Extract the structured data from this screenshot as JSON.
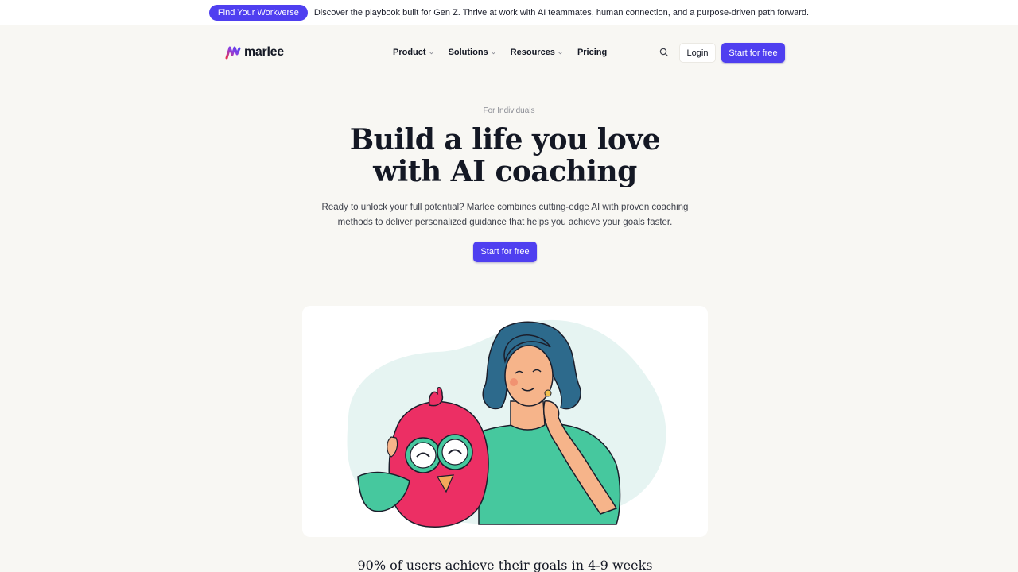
{
  "announcement": {
    "pill_label": "Find Your Workverse",
    "text": "Discover the playbook built for Gen Z. Thrive at work with AI teammates, human connection, and a purpose-driven path forward."
  },
  "brand": {
    "name": "marlee"
  },
  "nav": {
    "items": [
      {
        "label": "Product",
        "dropdown": true
      },
      {
        "label": "Solutions",
        "dropdown": true
      },
      {
        "label": "Resources",
        "dropdown": true
      },
      {
        "label": "Pricing",
        "dropdown": false
      }
    ],
    "login_label": "Login",
    "cta_label": "Start for free"
  },
  "hero": {
    "eyebrow": "For Individuals",
    "title_line1": "Build a life you love",
    "title_line2": "with AI coaching",
    "subtitle": "Ready to unlock your full potential? Marlee combines cutting-edge AI with proven coaching methods to deliver personalized guidance that helps you achieve your goals faster.",
    "cta_label": "Start for free"
  },
  "stats": {
    "headline": "90% of users achieve their goals in 4-9 weeks"
  },
  "colors": {
    "accent": "#4f3ff0",
    "background": "#f8f7f3",
    "owl": "#ec2f64",
    "shirt": "#46c89e",
    "hair": "#2d6a8c"
  },
  "icons": {
    "search": "search-icon",
    "chevron": "chevron-down-icon",
    "logo": "marlee-logo-icon"
  }
}
